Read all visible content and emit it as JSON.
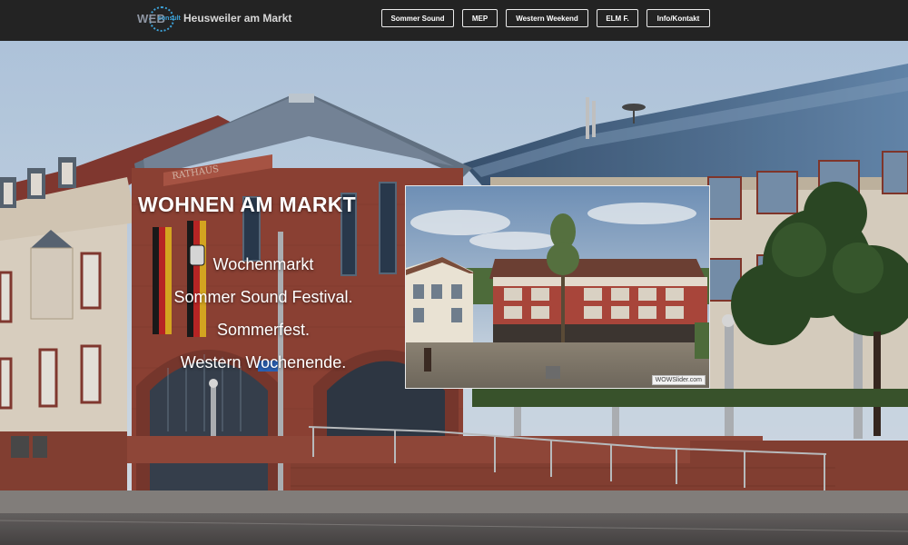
{
  "header": {
    "logo_text": "WEB",
    "logo_sub": "consult",
    "site_title": "Heusweiler am Markt",
    "nav": [
      {
        "label": "Sommer Sound"
      },
      {
        "label": "MEP"
      },
      {
        "label": "Western Weekend"
      },
      {
        "label": "ELM F."
      },
      {
        "label": "Info/Kontakt"
      }
    ]
  },
  "hero": {
    "heading": "WOHNEN AM MARKT",
    "lines": [
      "Wochenmarkt",
      "Sommer Sound Festival.",
      "Sommerfest.",
      "Western Wochenende."
    ],
    "building_sign": "RATHAUS"
  },
  "slider": {
    "credit": "WOWSlider.com"
  },
  "colors": {
    "navbar_bg": "#232323",
    "brick": "#9c4b3c",
    "sky": "#c7dbef",
    "facade_cream": "#eadfcf"
  }
}
